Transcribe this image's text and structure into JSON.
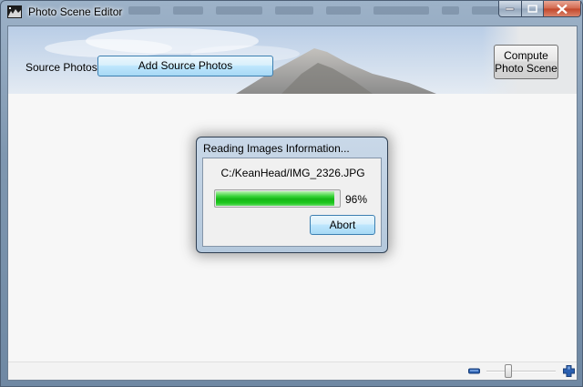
{
  "window": {
    "title": "Photo Scene Editor",
    "icon": "photo-scene-app-icon"
  },
  "header": {
    "source_label": "Source Photos",
    "add_button": "Add Source Photos",
    "compute_button_line1": "Compute",
    "compute_button_line2": "Photo Scene"
  },
  "dialog": {
    "title": "Reading Images Information...",
    "file_path": "C:/KeanHead/IMG_2326.JPG",
    "progress_percent": 96,
    "progress_label": "96%",
    "abort_button": "Abort"
  },
  "status_bar": {
    "zoom_out_icon": "zoom-out-icon",
    "zoom_in_icon": "zoom-in-icon",
    "zoom_level_fraction": 0.3
  },
  "colors": {
    "progress_green": "#15b715",
    "zoom_icon_blue": "#2a5fb0"
  }
}
